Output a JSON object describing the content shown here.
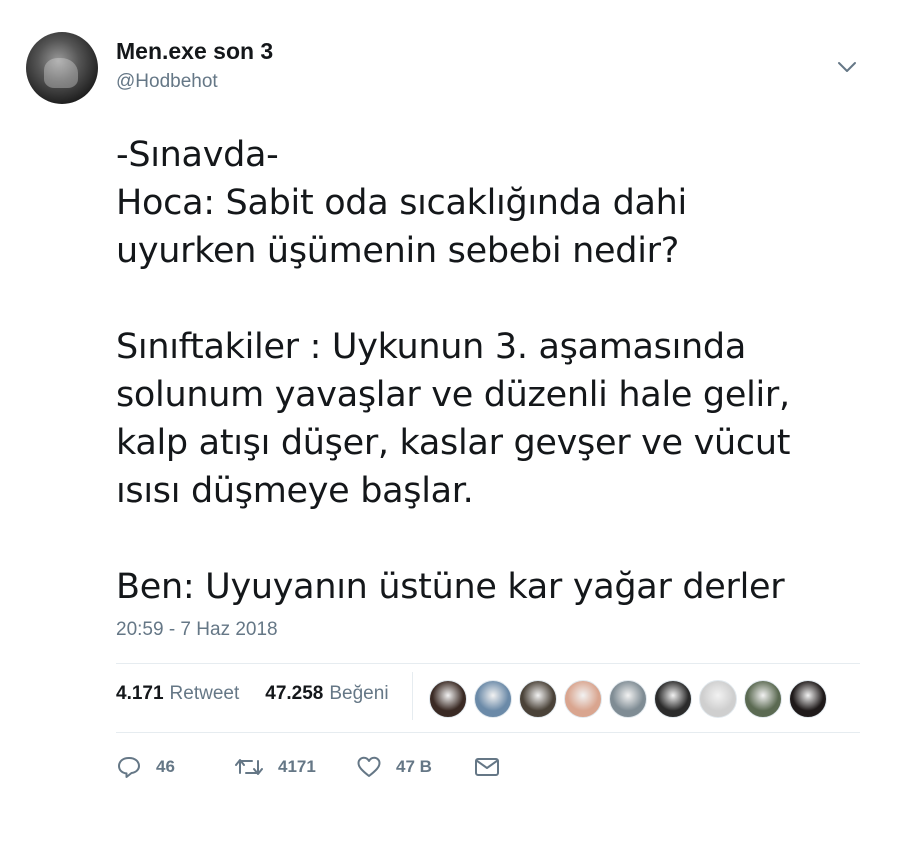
{
  "tweet": {
    "display_name": "Men.exe son 3",
    "handle": "@Hodbehot",
    "text": "-Sınavda-\nHoca: Sabit oda sıcaklığında dahi\nuyurken üşümenin sebebi nedir?\n\nSınıftakiler : Uykunun 3. aşamasında\nsolunum yavaşlar ve düzenli hale gelir,\nkalp atışı düşer, kaslar gevşer ve vücut\nısısı düşmeye başlar.\n\nBen: Uyuyanın üstüne kar yağar derler",
    "timestamp": "20:59 - 7 Haz 2018"
  },
  "stats": {
    "retweet_count": "4.171",
    "retweet_label": "Retweet",
    "like_count": "47.258",
    "like_label": "Beğeni"
  },
  "likers": [
    {
      "color": "#3a2a24"
    },
    {
      "color": "#6b8aa8"
    },
    {
      "color": "#4a4238"
    },
    {
      "color": "#d9a58f"
    },
    {
      "color": "#7f8c94"
    },
    {
      "color": "#2b2b2b"
    },
    {
      "color": "#cfcfcf"
    },
    {
      "color": "#5b6a52"
    },
    {
      "color": "#1f1a1a"
    }
  ],
  "actions": {
    "reply_count": "46",
    "retweet_count": "4171",
    "like_count": "47 B"
  },
  "icons": {
    "menu": "chevron-down-icon",
    "reply": "reply-icon",
    "retweet": "retweet-icon",
    "like": "heart-icon",
    "dm": "envelope-icon"
  }
}
